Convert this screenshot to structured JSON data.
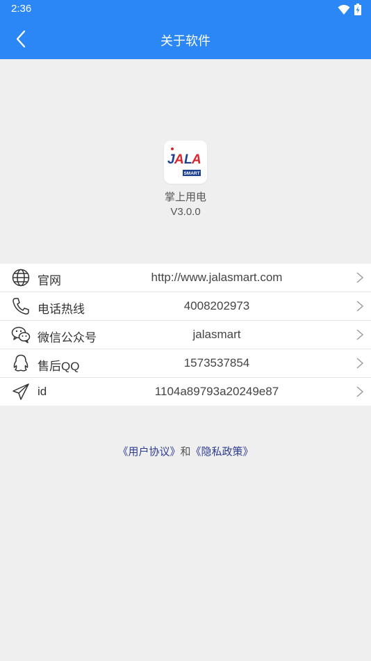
{
  "status_bar": {
    "time": "2:36"
  },
  "app_bar": {
    "title": "关于软件"
  },
  "app_info": {
    "name": "掌上用电",
    "version": "V3.0.0",
    "logo_text": "JALA",
    "logo_subtext": "SMART"
  },
  "rows": [
    {
      "icon": "globe-icon",
      "label": "官网",
      "value": "http://www.jalasmart.com"
    },
    {
      "icon": "phone-icon",
      "label": "电话热线",
      "value": "4008202973"
    },
    {
      "icon": "wechat-icon",
      "label": "微信公众号",
      "value": "jalasmart"
    },
    {
      "icon": "qq-icon",
      "label": "售后QQ",
      "value": "1573537854"
    },
    {
      "icon": "send-icon",
      "label": "id",
      "value": "1104a89793a20249e87"
    }
  ],
  "footer": {
    "user_agreement": "《用户协议》",
    "connector": "和",
    "privacy_policy": "《隐私政策》"
  },
  "colors": {
    "primary": "#2b87f6",
    "link": "#2e3c8f",
    "background": "#efefef"
  }
}
